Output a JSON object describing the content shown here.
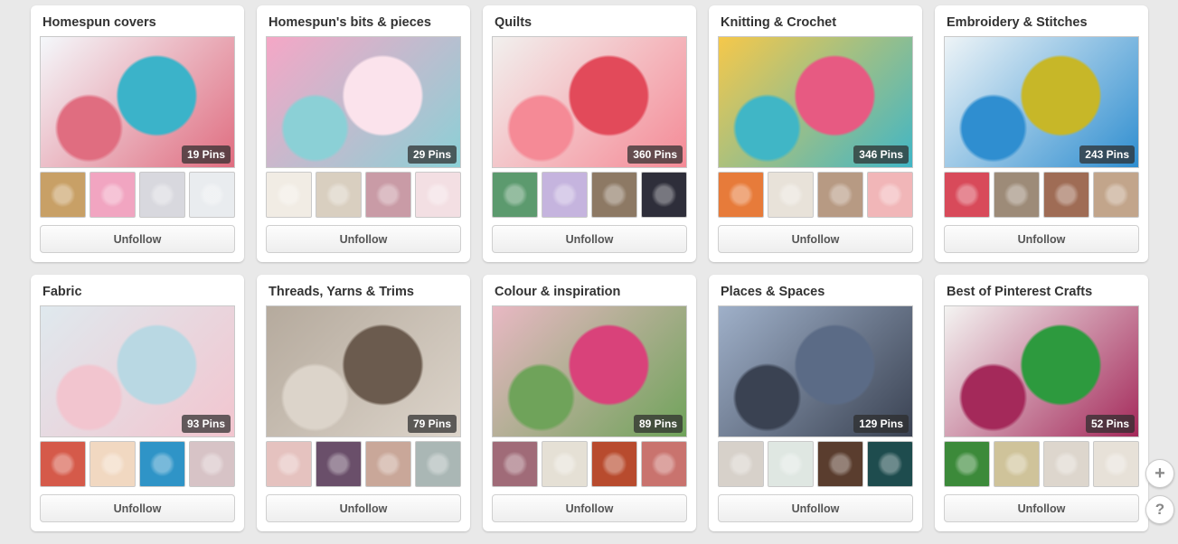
{
  "unfollow_label": "Unfollow",
  "floating": {
    "add_glyph": "+",
    "help_glyph": "?"
  },
  "rows": [
    {
      "boards": [
        {
          "title": "Homespun covers",
          "pins": "19 Pins",
          "cover_colors": [
            "#f4f8fb",
            "#3bb3c9",
            "#e06d80"
          ],
          "thumb_colors": [
            "#c8a066",
            "#f1a5c1",
            "#d8d8de",
            "#e9ecef"
          ]
        },
        {
          "title": "Homespun's bits & pieces",
          "pins": "29 Pins",
          "cover_colors": [
            "#f5a7c6",
            "#fbe3ec",
            "#8bd0d6"
          ],
          "thumb_colors": [
            "#f1ece4",
            "#d9cfc0",
            "#c99ba6",
            "#f3dfe3"
          ]
        },
        {
          "title": "Quilts",
          "pins": "360 Pins",
          "cover_colors": [
            "#f2f0ee",
            "#e24a5a",
            "#f58a96"
          ],
          "thumb_colors": [
            "#5c9a6e",
            "#c5b4de",
            "#8d7964",
            "#2e2e3a"
          ]
        },
        {
          "title": "Knitting & Crochet",
          "pins": "346 Pins",
          "cover_colors": [
            "#f6c84a",
            "#e75a82",
            "#40b6c6"
          ],
          "thumb_colors": [
            "#e77b3a",
            "#e8e2d9",
            "#b79a83",
            "#f1b6b8"
          ]
        },
        {
          "title": "Embroidery & Stitches",
          "pins": "243 Pins",
          "cover_colors": [
            "#eef4f7",
            "#c7b728",
            "#2f8ed0"
          ],
          "thumb_colors": [
            "#d84a5a",
            "#9d8b78",
            "#9f6c55",
            "#c2a58b"
          ]
        }
      ]
    },
    {
      "boards": [
        {
          "title": "Fabric",
          "pins": "93 Pins",
          "cover_colors": [
            "#dfe9ee",
            "#b9d8e3",
            "#f2c5cf"
          ],
          "thumb_colors": [
            "#d55a4a",
            "#f1d8c1",
            "#2f94c7",
            "#d7c3c6"
          ]
        },
        {
          "title": "Threads, Yarns & Trims",
          "pins": "79 Pins",
          "cover_colors": [
            "#b5aa9d",
            "#6b5b4e",
            "#dcd4ca"
          ],
          "thumb_colors": [
            "#e5c2bf",
            "#6a4f6a",
            "#c9a799",
            "#aab7b5"
          ]
        },
        {
          "title": "Colour & inspiration",
          "pins": "89 Pins",
          "cover_colors": [
            "#e8b8c3",
            "#d9427a",
            "#6fa35a"
          ],
          "thumb_colors": [
            "#a06b78",
            "#e5e0d5",
            "#b84b2e",
            "#c9736e"
          ]
        },
        {
          "title": "Places & Spaces",
          "pins": "129 Pins",
          "cover_colors": [
            "#9fb0c9",
            "#5b6b86",
            "#3a4252"
          ],
          "thumb_colors": [
            "#d7d1ca",
            "#dfe7e2",
            "#5a3d2e",
            "#1e4c4e"
          ]
        },
        {
          "title": "Best of Pinterest Crafts",
          "pins": "52 Pins",
          "cover_colors": [
            "#f4f4f2",
            "#2d9a3e",
            "#a4295a"
          ],
          "thumb_colors": [
            "#3c8a3a",
            "#cfc39a",
            "#ddd6cd",
            "#e7e1d8"
          ]
        }
      ]
    }
  ]
}
